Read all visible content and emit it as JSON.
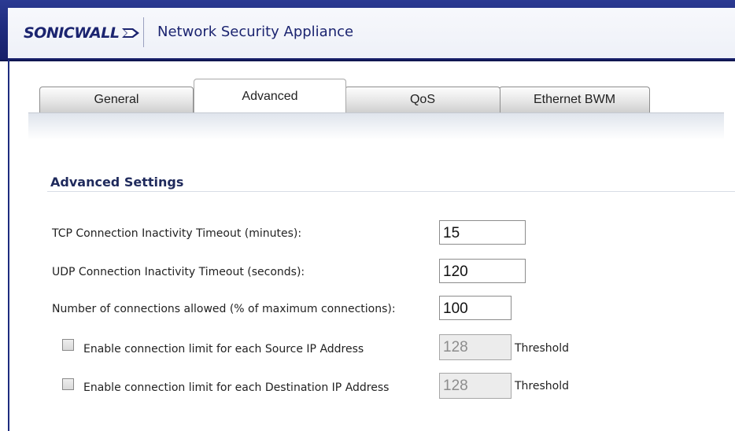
{
  "header": {
    "logo_text": "SONICWALL",
    "app_title": "Network Security Appliance"
  },
  "tabs": [
    {
      "label": "General",
      "active": false
    },
    {
      "label": "Advanced",
      "active": true
    },
    {
      "label": "QoS",
      "active": false
    },
    {
      "label": "Ethernet BWM",
      "active": false
    }
  ],
  "section": {
    "title": "Advanced Settings"
  },
  "fields": {
    "tcp_timeout": {
      "label": "TCP Connection Inactivity Timeout (minutes):",
      "value": "15"
    },
    "udp_timeout": {
      "label": "UDP Connection Inactivity Timeout (seconds):",
      "value": "120"
    },
    "conn_allowed": {
      "label": "Number of connections allowed (% of maximum connections):",
      "value": "100"
    },
    "src_ip_limit": {
      "label": "Enable connection limit for each Source IP Address",
      "checked": false,
      "value": "128",
      "suffix": "Threshold"
    },
    "dst_ip_limit": {
      "label": "Enable connection limit for each Destination IP Address",
      "checked": false,
      "value": "128",
      "suffix": "Threshold"
    }
  },
  "colors": {
    "header_blue": "#1f2c7e",
    "title_text": "#1b2470",
    "section_title": "#1f2a5c"
  }
}
